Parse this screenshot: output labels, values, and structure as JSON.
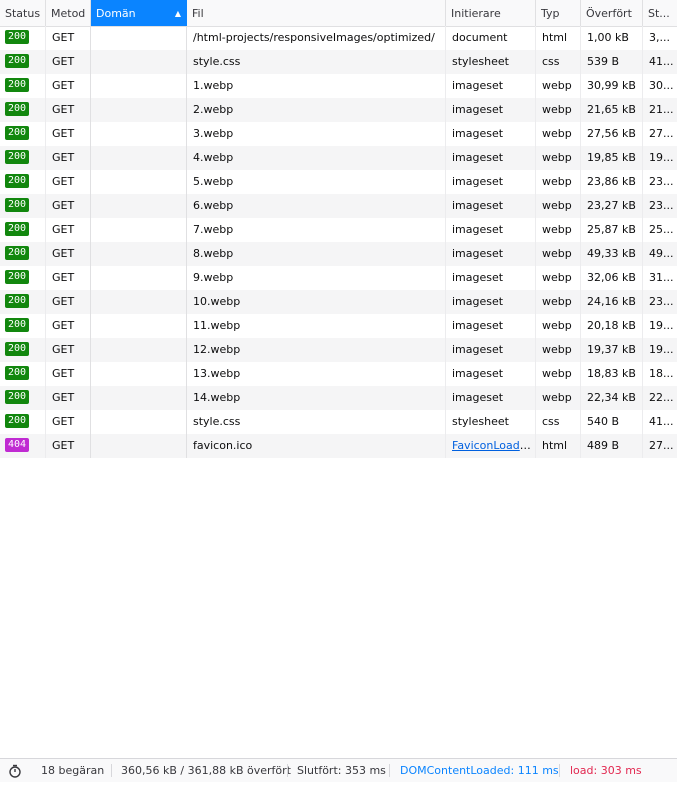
{
  "columns": {
    "status": "Status",
    "method": "Metod",
    "domain": "Domän",
    "file": "Fil",
    "initiator": "Initierare",
    "type": "Typ",
    "transferred": "Överfört",
    "size": "St..."
  },
  "colors": {
    "ok": "#12870e",
    "notfound": "#c02bd2",
    "active_header": "#0a84ff"
  },
  "requests": [
    {
      "status": "200",
      "method": "GET",
      "file": "/html-projects/responsiveImages/optimized/",
      "initiator": "document",
      "type": "html",
      "transferred": "1,00 kB",
      "size": "3,..."
    },
    {
      "status": "200",
      "method": "GET",
      "file": "style.css",
      "initiator": "stylesheet",
      "type": "css",
      "transferred": "539 B",
      "size": "41..."
    },
    {
      "status": "200",
      "method": "GET",
      "file": "1.webp",
      "initiator": "imageset",
      "type": "webp",
      "transferred": "30,99 kB",
      "size": "30..."
    },
    {
      "status": "200",
      "method": "GET",
      "file": "2.webp",
      "initiator": "imageset",
      "type": "webp",
      "transferred": "21,65 kB",
      "size": "21..."
    },
    {
      "status": "200",
      "method": "GET",
      "file": "3.webp",
      "initiator": "imageset",
      "type": "webp",
      "transferred": "27,56 kB",
      "size": "27..."
    },
    {
      "status": "200",
      "method": "GET",
      "file": "4.webp",
      "initiator": "imageset",
      "type": "webp",
      "transferred": "19,85 kB",
      "size": "19..."
    },
    {
      "status": "200",
      "method": "GET",
      "file": "5.webp",
      "initiator": "imageset",
      "type": "webp",
      "transferred": "23,86 kB",
      "size": "23..."
    },
    {
      "status": "200",
      "method": "GET",
      "file": "6.webp",
      "initiator": "imageset",
      "type": "webp",
      "transferred": "23,27 kB",
      "size": "23..."
    },
    {
      "status": "200",
      "method": "GET",
      "file": "7.webp",
      "initiator": "imageset",
      "type": "webp",
      "transferred": "25,87 kB",
      "size": "25..."
    },
    {
      "status": "200",
      "method": "GET",
      "file": "8.webp",
      "initiator": "imageset",
      "type": "webp",
      "transferred": "49,33 kB",
      "size": "49..."
    },
    {
      "status": "200",
      "method": "GET",
      "file": "9.webp",
      "initiator": "imageset",
      "type": "webp",
      "transferred": "32,06 kB",
      "size": "31..."
    },
    {
      "status": "200",
      "method": "GET",
      "file": "10.webp",
      "initiator": "imageset",
      "type": "webp",
      "transferred": "24,16 kB",
      "size": "23..."
    },
    {
      "status": "200",
      "method": "GET",
      "file": "11.webp",
      "initiator": "imageset",
      "type": "webp",
      "transferred": "20,18 kB",
      "size": "19..."
    },
    {
      "status": "200",
      "method": "GET",
      "file": "12.webp",
      "initiator": "imageset",
      "type": "webp",
      "transferred": "19,37 kB",
      "size": "19..."
    },
    {
      "status": "200",
      "method": "GET",
      "file": "13.webp",
      "initiator": "imageset",
      "type": "webp",
      "transferred": "18,83 kB",
      "size": "18..."
    },
    {
      "status": "200",
      "method": "GET",
      "file": "14.webp",
      "initiator": "imageset",
      "type": "webp",
      "transferred": "22,34 kB",
      "size": "22..."
    },
    {
      "status": "200",
      "method": "GET",
      "file": "style.css",
      "initiator": "stylesheet",
      "type": "css",
      "transferred": "540 B",
      "size": "41..."
    },
    {
      "status": "404",
      "method": "GET",
      "file": "favicon.ico",
      "initiator": "FaviconLoade...",
      "initiator_link": true,
      "type": "html",
      "transferred": "489 B",
      "size": "27..."
    }
  ],
  "footer": {
    "timer_icon": "stopwatch-icon",
    "requests": "18 begäran",
    "transferred": "360,56 kB / 361,88 kB överfört",
    "finished": "Slutfört: 353 ms",
    "dom_content_loaded": "DOMContentLoaded: 111 ms",
    "load": "load: 303 ms"
  }
}
